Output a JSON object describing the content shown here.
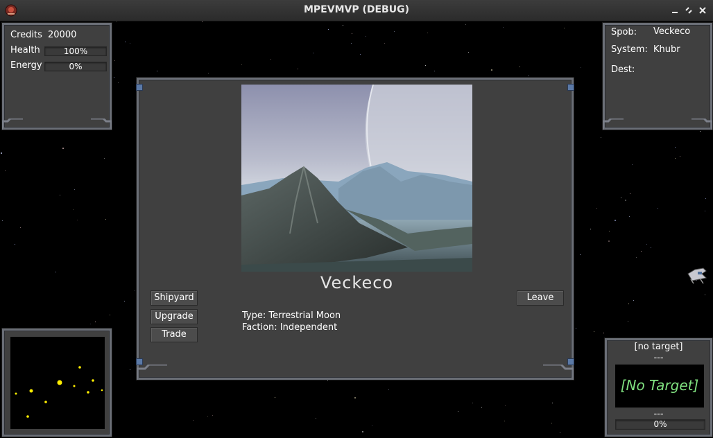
{
  "window": {
    "title": "MPEVMVP (DEBUG)"
  },
  "status_panel": {
    "credits_label": "Credits",
    "credits_value": "20000",
    "health_label": "Health",
    "health_value": "100%",
    "health_fraction": 1.0,
    "energy_label": "Energy",
    "energy_value": "0%",
    "energy_fraction": 0.0
  },
  "nav_panel": {
    "spob_label": "Spob:",
    "spob_value": "Veckeco",
    "system_label": "System:",
    "system_value": "Khubr",
    "dest_label": "Dest:",
    "dest_value": ""
  },
  "landing": {
    "planet_name": "Veckeco",
    "type_line": "Type: Terrestrial Moon",
    "faction_line": "Faction: Independent",
    "buttons": {
      "shipyard": "Shipyard",
      "upgrade": "Upgrade",
      "trade": "Trade",
      "leave": "Leave"
    }
  },
  "target_panel": {
    "header": "[no target]",
    "dashes_top": "---",
    "target_text": "[No Target]",
    "dashes_bottom": "---",
    "shield_value": "0%",
    "colors": {
      "target_text": "#7fe07f"
    }
  },
  "colors": {
    "panel": "#404040",
    "frame": "#6a6e76",
    "radar_dot": "#ffee00",
    "accent_blue": "#5b79a6"
  }
}
